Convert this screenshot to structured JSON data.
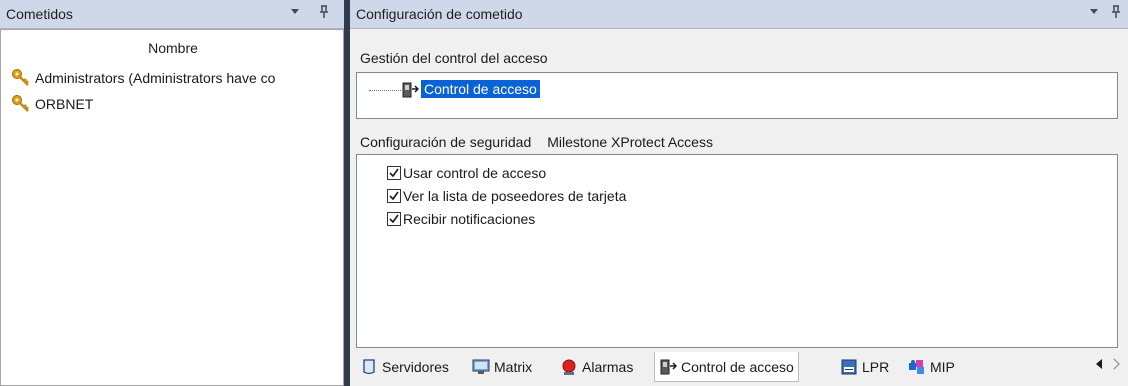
{
  "left_panel": {
    "title": "Cometidos",
    "dropdown_glyph": "▼",
    "pin_glyph": "⊥",
    "column_header": "Nombre",
    "roles": [
      {
        "label": "Administrators (Administrators have co",
        "icon": "role-key-icon"
      },
      {
        "label": "ORBNET",
        "icon": "role-key-icon"
      }
    ]
  },
  "right_panel": {
    "title": "Configuración de cometido",
    "dropdown_glyph": "▼",
    "pin_glyph": "⊥",
    "access_section": {
      "label": "Gestión del control del acceso",
      "tree_item": "Control de acceso"
    },
    "security_tabs": [
      "Configuración de seguridad",
      "Milestone XProtect Access"
    ],
    "permissions": [
      {
        "label": "Usar control de acceso",
        "checked": true
      },
      {
        "label": "Ver la lista de poseedores de tarjeta",
        "checked": true
      },
      {
        "label": "Recibir notificaciones",
        "checked": true
      }
    ]
  },
  "bottom_tabs": [
    {
      "label": "Servidores",
      "icon": "servers-icon",
      "active": false
    },
    {
      "label": "Matrix",
      "icon": "matrix-icon",
      "active": false
    },
    {
      "label": "Alarmas",
      "icon": "alarm-icon",
      "active": false
    },
    {
      "label": "Control de acceso",
      "icon": "access-control-icon",
      "active": true
    },
    {
      "label": "LPR",
      "icon": "lpr-icon",
      "active": false
    },
    {
      "label": "MIP",
      "icon": "mip-icon",
      "active": false
    }
  ],
  "scroll": {
    "left": "◀",
    "right": "▶"
  },
  "colors": {
    "header_bg": "#cfd8e9",
    "selection": "#0a63d6",
    "frame": "#2f3a4c"
  }
}
